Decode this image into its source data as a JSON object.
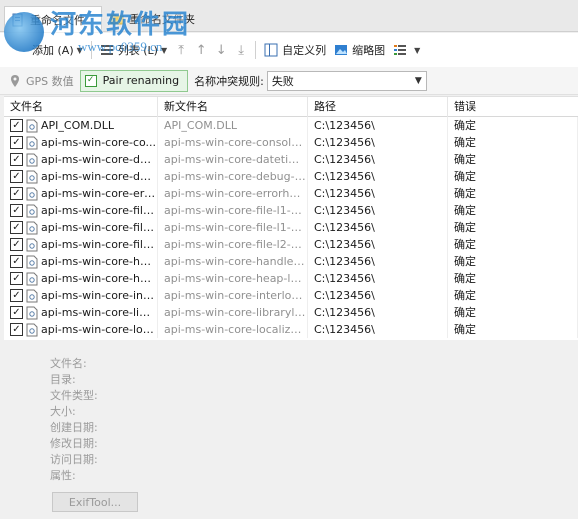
{
  "tabs": [
    {
      "label": "重命名文件",
      "icon": "file-rename-icon",
      "active": true
    },
    {
      "label": "重命名文件夹",
      "icon": "folder-rename-icon",
      "active": false
    }
  ],
  "watermark": {
    "name": "河东软件园",
    "url": "www.pc0359.cn"
  },
  "toolbar": {
    "add_label": "添加 (A)",
    "list_label": "列表 (L)",
    "custom_columns_label": "自定义列",
    "thumbnails_label": "缩略图"
  },
  "options": {
    "gps_label": "GPS 数值",
    "pair_label": "Pair renaming",
    "conflict_label": "名称冲突规则:",
    "conflict_value": "失败"
  },
  "table": {
    "headers": [
      "文件名",
      "新文件名",
      "路径",
      "错误"
    ],
    "rows": [
      {
        "name": "API_COM.DLL",
        "new_name": "API_COM.DLL",
        "path": "C:\\123456\\",
        "error": "确定"
      },
      {
        "name": "api-ms-win-core-co...",
        "new_name": "api-ms-win-core-console-l...",
        "path": "C:\\123456\\",
        "error": "确定"
      },
      {
        "name": "api-ms-win-core-dat...",
        "new_name": "api-ms-win-core-datetime...",
        "path": "C:\\123456\\",
        "error": "确定"
      },
      {
        "name": "api-ms-win-core-de...",
        "new_name": "api-ms-win-core-debug-l1...",
        "path": "C:\\123456\\",
        "error": "确定"
      },
      {
        "name": "api-ms-win-core-err...",
        "new_name": "api-ms-win-core-errorhan...",
        "path": "C:\\123456\\",
        "error": "确定"
      },
      {
        "name": "api-ms-win-core-file...",
        "new_name": "api-ms-win-core-file-l1-1-...",
        "path": "C:\\123456\\",
        "error": "确定"
      },
      {
        "name": "api-ms-win-core-file...",
        "new_name": "api-ms-win-core-file-l1-2-...",
        "path": "C:\\123456\\",
        "error": "确定"
      },
      {
        "name": "api-ms-win-core-file...",
        "new_name": "api-ms-win-core-file-l2-1-...",
        "path": "C:\\123456\\",
        "error": "确定"
      },
      {
        "name": "api-ms-win-core-ha...",
        "new_name": "api-ms-win-core-handle-l1...",
        "path": "C:\\123456\\",
        "error": "确定"
      },
      {
        "name": "api-ms-win-core-he...",
        "new_name": "api-ms-win-core-heap-l1-1...",
        "path": "C:\\123456\\",
        "error": "确定"
      },
      {
        "name": "api-ms-win-core-int...",
        "new_name": "api-ms-win-core-interlock...",
        "path": "C:\\123456\\",
        "error": "确定"
      },
      {
        "name": "api-ms-win-core-libr...",
        "new_name": "api-ms-win-core-libraryloa...",
        "path": "C:\\123456\\",
        "error": "确定"
      },
      {
        "name": "api-ms-win-core-loc...",
        "new_name": "api-ms-win-core-localizati...",
        "path": "C:\\123456\\",
        "error": "确定"
      }
    ]
  },
  "info": {
    "file_name": "文件名:",
    "directory": "目录:",
    "file_type": "文件类型:",
    "size": "大小:",
    "created": "创建日期:",
    "modified": "修改日期:",
    "accessed": "访问日期:",
    "attributes": "属性:"
  },
  "exif_button": "ExifTool...",
  "colors": {
    "accent": "#2b86d1",
    "pair_bg": "#e6f5e6",
    "pair_border": "#8fc98f",
    "disabled_text": "#9a9a9a"
  }
}
